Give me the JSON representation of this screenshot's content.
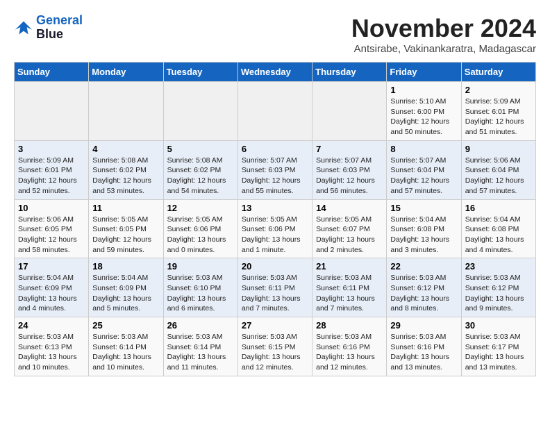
{
  "header": {
    "logo_line1": "General",
    "logo_line2": "Blue",
    "month_year": "November 2024",
    "location": "Antsirabe, Vakinankaratra, Madagascar"
  },
  "days_of_week": [
    "Sunday",
    "Monday",
    "Tuesday",
    "Wednesday",
    "Thursday",
    "Friday",
    "Saturday"
  ],
  "weeks": [
    [
      {
        "day": "",
        "info": ""
      },
      {
        "day": "",
        "info": ""
      },
      {
        "day": "",
        "info": ""
      },
      {
        "day": "",
        "info": ""
      },
      {
        "day": "",
        "info": ""
      },
      {
        "day": "1",
        "info": "Sunrise: 5:10 AM\nSunset: 6:00 PM\nDaylight: 12 hours\nand 50 minutes."
      },
      {
        "day": "2",
        "info": "Sunrise: 5:09 AM\nSunset: 6:01 PM\nDaylight: 12 hours\nand 51 minutes."
      }
    ],
    [
      {
        "day": "3",
        "info": "Sunrise: 5:09 AM\nSunset: 6:01 PM\nDaylight: 12 hours\nand 52 minutes."
      },
      {
        "day": "4",
        "info": "Sunrise: 5:08 AM\nSunset: 6:02 PM\nDaylight: 12 hours\nand 53 minutes."
      },
      {
        "day": "5",
        "info": "Sunrise: 5:08 AM\nSunset: 6:02 PM\nDaylight: 12 hours\nand 54 minutes."
      },
      {
        "day": "6",
        "info": "Sunrise: 5:07 AM\nSunset: 6:03 PM\nDaylight: 12 hours\nand 55 minutes."
      },
      {
        "day": "7",
        "info": "Sunrise: 5:07 AM\nSunset: 6:03 PM\nDaylight: 12 hours\nand 56 minutes."
      },
      {
        "day": "8",
        "info": "Sunrise: 5:07 AM\nSunset: 6:04 PM\nDaylight: 12 hours\nand 57 minutes."
      },
      {
        "day": "9",
        "info": "Sunrise: 5:06 AM\nSunset: 6:04 PM\nDaylight: 12 hours\nand 57 minutes."
      }
    ],
    [
      {
        "day": "10",
        "info": "Sunrise: 5:06 AM\nSunset: 6:05 PM\nDaylight: 12 hours\nand 58 minutes."
      },
      {
        "day": "11",
        "info": "Sunrise: 5:05 AM\nSunset: 6:05 PM\nDaylight: 12 hours\nand 59 minutes."
      },
      {
        "day": "12",
        "info": "Sunrise: 5:05 AM\nSunset: 6:06 PM\nDaylight: 13 hours\nand 0 minutes."
      },
      {
        "day": "13",
        "info": "Sunrise: 5:05 AM\nSunset: 6:06 PM\nDaylight: 13 hours\nand 1 minute."
      },
      {
        "day": "14",
        "info": "Sunrise: 5:05 AM\nSunset: 6:07 PM\nDaylight: 13 hours\nand 2 minutes."
      },
      {
        "day": "15",
        "info": "Sunrise: 5:04 AM\nSunset: 6:08 PM\nDaylight: 13 hours\nand 3 minutes."
      },
      {
        "day": "16",
        "info": "Sunrise: 5:04 AM\nSunset: 6:08 PM\nDaylight: 13 hours\nand 4 minutes."
      }
    ],
    [
      {
        "day": "17",
        "info": "Sunrise: 5:04 AM\nSunset: 6:09 PM\nDaylight: 13 hours\nand 4 minutes."
      },
      {
        "day": "18",
        "info": "Sunrise: 5:04 AM\nSunset: 6:09 PM\nDaylight: 13 hours\nand 5 minutes."
      },
      {
        "day": "19",
        "info": "Sunrise: 5:03 AM\nSunset: 6:10 PM\nDaylight: 13 hours\nand 6 minutes."
      },
      {
        "day": "20",
        "info": "Sunrise: 5:03 AM\nSunset: 6:11 PM\nDaylight: 13 hours\nand 7 minutes."
      },
      {
        "day": "21",
        "info": "Sunrise: 5:03 AM\nSunset: 6:11 PM\nDaylight: 13 hours\nand 7 minutes."
      },
      {
        "day": "22",
        "info": "Sunrise: 5:03 AM\nSunset: 6:12 PM\nDaylight: 13 hours\nand 8 minutes."
      },
      {
        "day": "23",
        "info": "Sunrise: 5:03 AM\nSunset: 6:12 PM\nDaylight: 13 hours\nand 9 minutes."
      }
    ],
    [
      {
        "day": "24",
        "info": "Sunrise: 5:03 AM\nSunset: 6:13 PM\nDaylight: 13 hours\nand 10 minutes."
      },
      {
        "day": "25",
        "info": "Sunrise: 5:03 AM\nSunset: 6:14 PM\nDaylight: 13 hours\nand 10 minutes."
      },
      {
        "day": "26",
        "info": "Sunrise: 5:03 AM\nSunset: 6:14 PM\nDaylight: 13 hours\nand 11 minutes."
      },
      {
        "day": "27",
        "info": "Sunrise: 5:03 AM\nSunset: 6:15 PM\nDaylight: 13 hours\nand 12 minutes."
      },
      {
        "day": "28",
        "info": "Sunrise: 5:03 AM\nSunset: 6:16 PM\nDaylight: 13 hours\nand 12 minutes."
      },
      {
        "day": "29",
        "info": "Sunrise: 5:03 AM\nSunset: 6:16 PM\nDaylight: 13 hours\nand 13 minutes."
      },
      {
        "day": "30",
        "info": "Sunrise: 5:03 AM\nSunset: 6:17 PM\nDaylight: 13 hours\nand 13 minutes."
      }
    ]
  ]
}
